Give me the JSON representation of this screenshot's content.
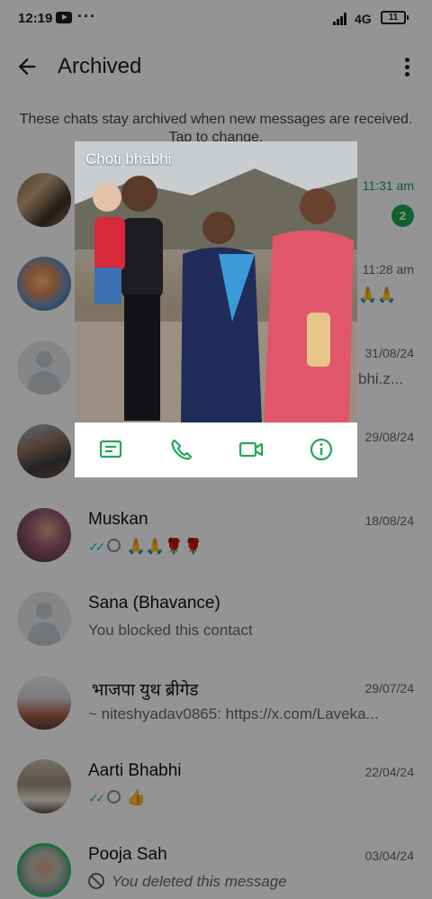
{
  "status_bar": {
    "time": "12:19",
    "network": "4G",
    "battery": "11"
  },
  "header": {
    "title": "Archived"
  },
  "info": "These chats stay archived when new messages are received. Tap to change.",
  "chats": [
    {
      "name": "",
      "date": "11:31 am",
      "preview": "",
      "unread": "2"
    },
    {
      "name": "",
      "date": "11:28 am",
      "preview": "🙏🙏"
    },
    {
      "name": "",
      "date": "31/08/24",
      "preview": "bhi.z..."
    },
    {
      "name": "",
      "date": "29/08/24",
      "preview": ""
    },
    {
      "name": "Muskan",
      "date": "18/08/24",
      "preview": "🙏🙏🌹🌹"
    },
    {
      "name": "Sana (Bhavance)",
      "date": "",
      "preview": "You blocked this contact"
    },
    {
      "name": "भाजपा युथ ब्रीगेड",
      "date": "29/07/24",
      "preview": "~ niteshyadav0865: https://x.com/Laveka..."
    },
    {
      "name": "Aarti Bhabhi",
      "date": "22/04/24",
      "preview": "👍"
    },
    {
      "name": "Pooja Sah",
      "date": "03/04/24",
      "preview": "You deleted this message"
    }
  ],
  "popup": {
    "name": "Choti bhabhi"
  },
  "colors": {
    "accent": "#1fa855",
    "ticks": "#35a3f0"
  },
  "icons": {
    "popup_actions": [
      "message-icon",
      "call-icon",
      "video-call-icon",
      "info-icon"
    ]
  }
}
